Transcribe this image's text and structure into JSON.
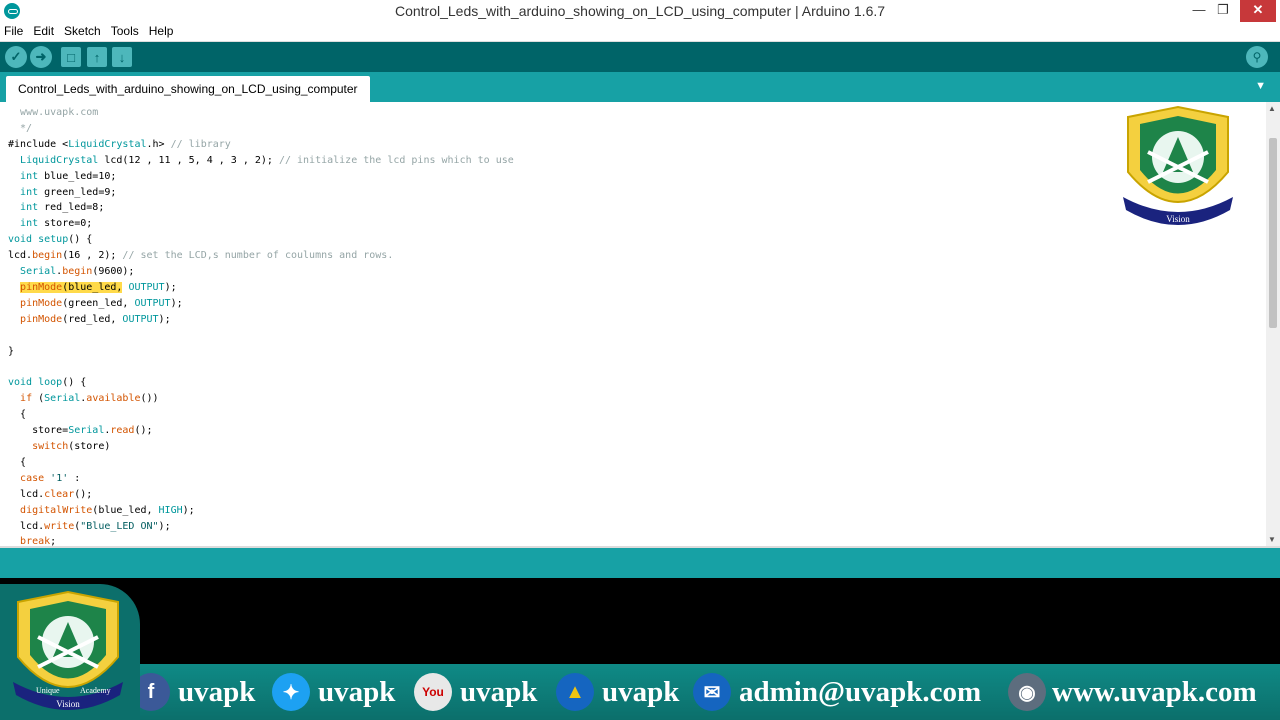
{
  "window": {
    "title": "Control_Leds_with_arduino_showing_on_LCD_using_computer | Arduino 1.6.7"
  },
  "menu": [
    "File",
    "Edit",
    "Sketch",
    "Tools",
    "Help"
  ],
  "tab": {
    "label": "Control_Leds_with_arduino_showing_on_LCD_using_computer"
  },
  "logo": {
    "text_top": "Unique",
    "text_bottom": "Academy",
    "text_mid": "Vision"
  },
  "social": {
    "facebook": "uvapk",
    "twitter": "uvapk",
    "youtube": "uvapk",
    "other": "uvapk",
    "email": "admin@uvapk.com",
    "website": "www.uvapk.com"
  },
  "colors": {
    "accent": "#17a1a5",
    "toolbar": "#006468",
    "highlight": "#ffda4a"
  }
}
